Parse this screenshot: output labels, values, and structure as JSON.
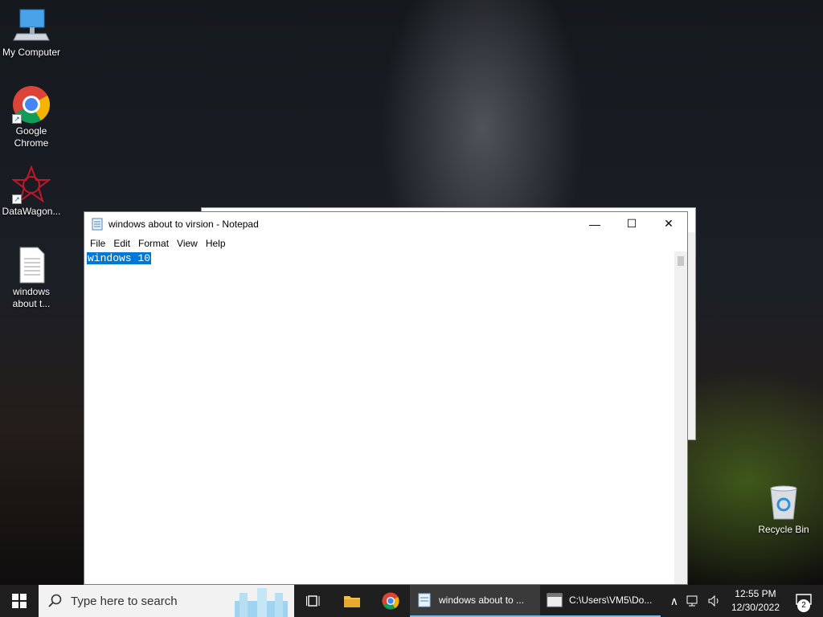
{
  "desktop": {
    "icons": [
      {
        "label": "My Computer"
      },
      {
        "label": "Google Chrome"
      },
      {
        "label": "DataWagon..."
      },
      {
        "label": "windows about t..."
      },
      {
        "label": "Recycle Bin"
      }
    ]
  },
  "notepad": {
    "title": "windows about to virsion - Notepad",
    "menu": [
      "File",
      "Edit",
      "Format",
      "View",
      "Help"
    ],
    "content": "windows 10",
    "controls": {
      "minimize": "—",
      "maximize": "☐",
      "close": "✕"
    }
  },
  "taskbar": {
    "search_placeholder": "Type here to search",
    "apps": [
      {
        "label": "windows about to ..."
      },
      {
        "label": "C:\\Users\\VM5\\Do..."
      }
    ],
    "clock": {
      "time": "12:55 PM",
      "date": "12/30/2022"
    },
    "notifications": "2"
  },
  "colors": {
    "selection": "#0078d7",
    "taskbar": "#1f1f1f",
    "accent": "#76b9ed"
  }
}
